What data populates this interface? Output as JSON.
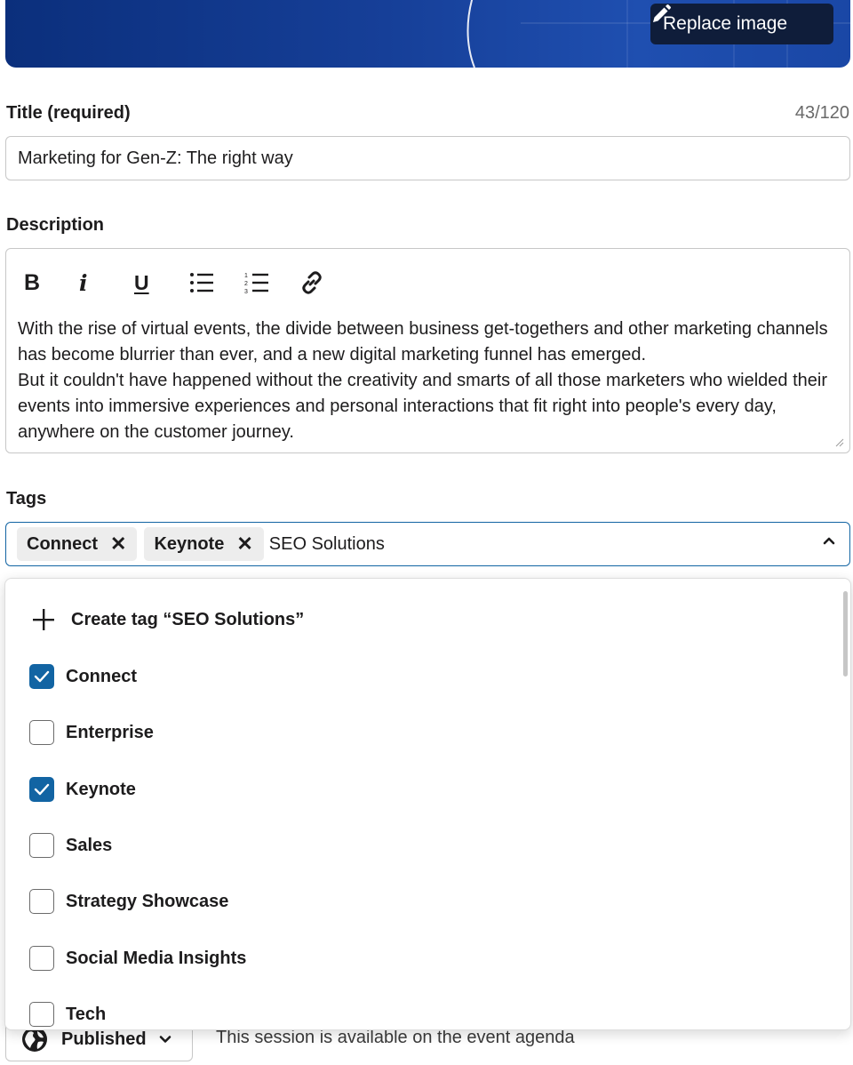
{
  "header": {
    "replace_image_label": "Replace image"
  },
  "title_field": {
    "label": "Title (required)",
    "counter": "43/120",
    "value": "Marketing for Gen-Z: The right way"
  },
  "description": {
    "label": "Description",
    "toolbar": {
      "bold": "B",
      "italic": "i",
      "underline": "U"
    },
    "paragraphs": [
      "With the rise of virtual events, the divide between business get-togethers and other marketing channels has become blurrier than ever, and a new digital marketing funnel has emerged.",
      "But it couldn't have happened without the creativity and smarts of all those marketers who wielded their events into immersive experiences and personal interactions that fit right into people's every day, anywhere on the customer journey."
    ]
  },
  "tags": {
    "label": "Tags",
    "selected": [
      {
        "label": "Connect"
      },
      {
        "label": "Keynote"
      }
    ],
    "chip_remove": "✕",
    "query": "SEO Solutions",
    "create_label": "Create tag “SEO Solutions”",
    "options": [
      {
        "label": "Connect",
        "checked": true
      },
      {
        "label": "Enterprise",
        "checked": false
      },
      {
        "label": "Keynote",
        "checked": true
      },
      {
        "label": "Sales",
        "checked": false
      },
      {
        "label": "Strategy Showcase",
        "checked": false
      },
      {
        "label": "Social Media Insights",
        "checked": false
      },
      {
        "label": "Tech",
        "checked": false
      }
    ]
  },
  "status": {
    "value": "Published",
    "description": "This session is available on the event agenda"
  },
  "colors": {
    "accent": "#1264a3",
    "hero": "#163f98",
    "button_dark": "#0f1d3a"
  }
}
